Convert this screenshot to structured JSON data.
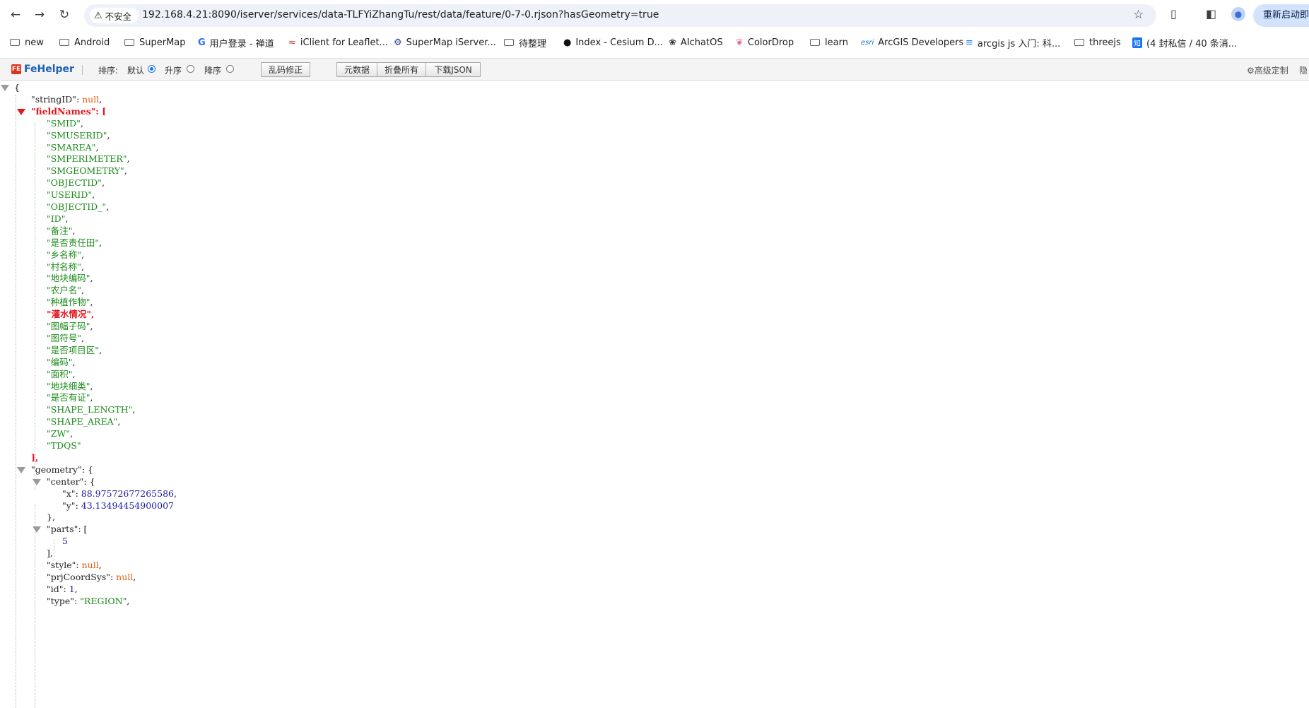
{
  "browser": {
    "security_label": "不安全",
    "url": "192.168.4.21:8090/iserver/services/data-TLFYiZhangTu/rest/data/feature/0-7-0.rjson?hasGeometry=true",
    "restart_label": "重新启动即可"
  },
  "bookmarks": [
    {
      "label": "new",
      "icon": "folder-icon"
    },
    {
      "label": "Android",
      "icon": "folder-icon"
    },
    {
      "label": "SuperMap",
      "icon": "folder-icon"
    },
    {
      "label": "用户登录 - 禅道",
      "icon": "chandao-icon"
    },
    {
      "label": "iClient for Leaflet...",
      "icon": "supermap-icon"
    },
    {
      "label": "SuperMap iServer...",
      "icon": "supermap-gear-icon"
    },
    {
      "label": "待整理",
      "icon": "folder-icon"
    },
    {
      "label": "Index - Cesium D...",
      "icon": "cesium-icon"
    },
    {
      "label": "AIchatOS",
      "icon": "openai-icon"
    },
    {
      "label": "ColorDrop",
      "icon": "colordrop-icon"
    },
    {
      "label": "learn",
      "icon": "folder-icon"
    },
    {
      "label": "ArcGIS Developers",
      "icon": "esri-icon"
    },
    {
      "label": "arcgis js 入门: 科...",
      "icon": "juejin-icon"
    },
    {
      "label": "threejs",
      "icon": "folder-icon"
    },
    {
      "label": "(4 封私信 / 40 条消...",
      "icon": "zhihu-icon"
    }
  ],
  "fehelper": {
    "title": "FeHelper",
    "badge": "FE",
    "sort_label": "排序:",
    "sort_options": [
      "默认",
      "升序",
      "降序"
    ],
    "fix_button": "乱码修正",
    "buttons": [
      "元数据",
      "折叠所有",
      "下载JSON"
    ],
    "advanced": "⚙高级定制",
    "hide": "隐"
  },
  "json_lines": [
    {
      "indent": 0,
      "parts": [
        [
          "p",
          "{"
        ]
      ],
      "toggle": "grey"
    },
    {
      "indent": 1,
      "parts": [
        [
          "k",
          "\"stringID\""
        ],
        [
          "p",
          ":  "
        ],
        [
          "nl",
          "null"
        ],
        [
          "p",
          ","
        ]
      ]
    },
    {
      "indent": 1,
      "parts": [
        [
          "hl",
          "\"fieldNames\""
        ],
        [
          "hl",
          ":  ["
        ]
      ],
      "toggle": "red"
    },
    {
      "indent": 2,
      "parts": [
        [
          "s",
          "\"SMID\""
        ],
        [
          "p",
          ","
        ]
      ]
    },
    {
      "indent": 2,
      "parts": [
        [
          "s",
          "\"SMUSERID\""
        ],
        [
          "p",
          ","
        ]
      ]
    },
    {
      "indent": 2,
      "parts": [
        [
          "s",
          "\"SMAREA\""
        ],
        [
          "p",
          ","
        ]
      ]
    },
    {
      "indent": 2,
      "parts": [
        [
          "s",
          "\"SMPERIMETER\""
        ],
        [
          "p",
          ","
        ]
      ]
    },
    {
      "indent": 2,
      "parts": [
        [
          "s",
          "\"SMGEOMETRY\""
        ],
        [
          "p",
          ","
        ]
      ]
    },
    {
      "indent": 2,
      "parts": [
        [
          "s",
          "\"OBJECTID\""
        ],
        [
          "p",
          ","
        ]
      ]
    },
    {
      "indent": 2,
      "parts": [
        [
          "s",
          "\"USERID\""
        ],
        [
          "p",
          ","
        ]
      ]
    },
    {
      "indent": 2,
      "parts": [
        [
          "s",
          "\"OBJECTID_\""
        ],
        [
          "p",
          ","
        ]
      ]
    },
    {
      "indent": 2,
      "parts": [
        [
          "s",
          "\"ID\""
        ],
        [
          "p",
          ","
        ]
      ]
    },
    {
      "indent": 2,
      "parts": [
        [
          "s",
          "\"备注\""
        ],
        [
          "p",
          ","
        ]
      ]
    },
    {
      "indent": 2,
      "parts": [
        [
          "s",
          "\"是否责任田\""
        ],
        [
          "p",
          ","
        ]
      ]
    },
    {
      "indent": 2,
      "parts": [
        [
          "s",
          "\"乡名称\""
        ],
        [
          "p",
          ","
        ]
      ]
    },
    {
      "indent": 2,
      "parts": [
        [
          "s",
          "\"村名称\""
        ],
        [
          "p",
          ","
        ]
      ]
    },
    {
      "indent": 2,
      "parts": [
        [
          "s",
          "\"地块编码\""
        ],
        [
          "p",
          ","
        ]
      ]
    },
    {
      "indent": 2,
      "parts": [
        [
          "s",
          "\"农户名\""
        ],
        [
          "p",
          ","
        ]
      ]
    },
    {
      "indent": 2,
      "parts": [
        [
          "s",
          "\"种植作物\""
        ],
        [
          "p",
          ","
        ]
      ]
    },
    {
      "indent": 2,
      "parts": [
        [
          "hl",
          "\"灌水情况\""
        ],
        [
          "hl",
          ","
        ]
      ]
    },
    {
      "indent": 2,
      "parts": [
        [
          "s",
          "\"图幅子码\""
        ],
        [
          "p",
          ","
        ]
      ]
    },
    {
      "indent": 2,
      "parts": [
        [
          "s",
          "\"图符号\""
        ],
        [
          "p",
          ","
        ]
      ]
    },
    {
      "indent": 2,
      "parts": [
        [
          "s",
          "\"是否项目区\""
        ],
        [
          "p",
          ","
        ]
      ]
    },
    {
      "indent": 2,
      "parts": [
        [
          "s",
          "\"编码\""
        ],
        [
          "p",
          ","
        ]
      ]
    },
    {
      "indent": 2,
      "parts": [
        [
          "s",
          "\"面积\""
        ],
        [
          "p",
          ","
        ]
      ]
    },
    {
      "indent": 2,
      "parts": [
        [
          "s",
          "\"地块细类\""
        ],
        [
          "p",
          ","
        ]
      ]
    },
    {
      "indent": 2,
      "parts": [
        [
          "s",
          "\"是否有证\""
        ],
        [
          "p",
          ","
        ]
      ]
    },
    {
      "indent": 2,
      "parts": [
        [
          "s",
          "\"SHAPE_LENGTH\""
        ],
        [
          "p",
          ","
        ]
      ]
    },
    {
      "indent": 2,
      "parts": [
        [
          "s",
          "\"SHAPE_AREA\""
        ],
        [
          "p",
          ","
        ]
      ]
    },
    {
      "indent": 2,
      "parts": [
        [
          "s",
          "\"ZW\""
        ],
        [
          "p",
          ","
        ]
      ]
    },
    {
      "indent": 2,
      "parts": [
        [
          "s",
          "\"TDQS\""
        ]
      ]
    },
    {
      "indent": 1,
      "parts": [
        [
          "hl",
          "],"
        ]
      ]
    },
    {
      "indent": 1,
      "parts": [
        [
          "k",
          "\"geometry\""
        ],
        [
          "p",
          ":  {"
        ]
      ],
      "toggle": "grey"
    },
    {
      "indent": 2,
      "parts": [
        [
          "k",
          "\"center\""
        ],
        [
          "p",
          ":  {"
        ]
      ],
      "toggle": "grey"
    },
    {
      "indent": 3,
      "parts": [
        [
          "k",
          "\"x\""
        ],
        [
          "p",
          ":  "
        ],
        [
          "n",
          "88.97572677265586"
        ],
        [
          "p",
          ","
        ]
      ]
    },
    {
      "indent": 3,
      "parts": [
        [
          "k",
          "\"y\""
        ],
        [
          "p",
          ":  "
        ],
        [
          "n",
          "43.13494454900007"
        ]
      ]
    },
    {
      "indent": 2,
      "parts": [
        [
          "p",
          "},"
        ]
      ]
    },
    {
      "indent": 2,
      "parts": [
        [
          "k",
          "\"parts\""
        ],
        [
          "p",
          ":  ["
        ]
      ],
      "toggle": "grey"
    },
    {
      "indent": 3,
      "parts": [
        [
          "n",
          "5"
        ]
      ]
    },
    {
      "indent": 2,
      "parts": [
        [
          "p",
          "],"
        ]
      ]
    },
    {
      "indent": 2,
      "parts": [
        [
          "k",
          "\"style\""
        ],
        [
          "p",
          ":  "
        ],
        [
          "nl",
          "null"
        ],
        [
          "p",
          ","
        ]
      ]
    },
    {
      "indent": 2,
      "parts": [
        [
          "k",
          "\"prjCoordSys\""
        ],
        [
          "p",
          ":  "
        ],
        [
          "nl",
          "null"
        ],
        [
          "p",
          ","
        ]
      ]
    },
    {
      "indent": 2,
      "parts": [
        [
          "k",
          "\"id\""
        ],
        [
          "p",
          ":  "
        ],
        [
          "n",
          "1"
        ],
        [
          "p",
          ","
        ]
      ]
    },
    {
      "indent": 2,
      "parts": [
        [
          "k",
          "\"type\""
        ],
        [
          "p",
          ":  "
        ],
        [
          "s",
          "\"REGION\""
        ],
        [
          "p",
          ","
        ]
      ]
    }
  ]
}
